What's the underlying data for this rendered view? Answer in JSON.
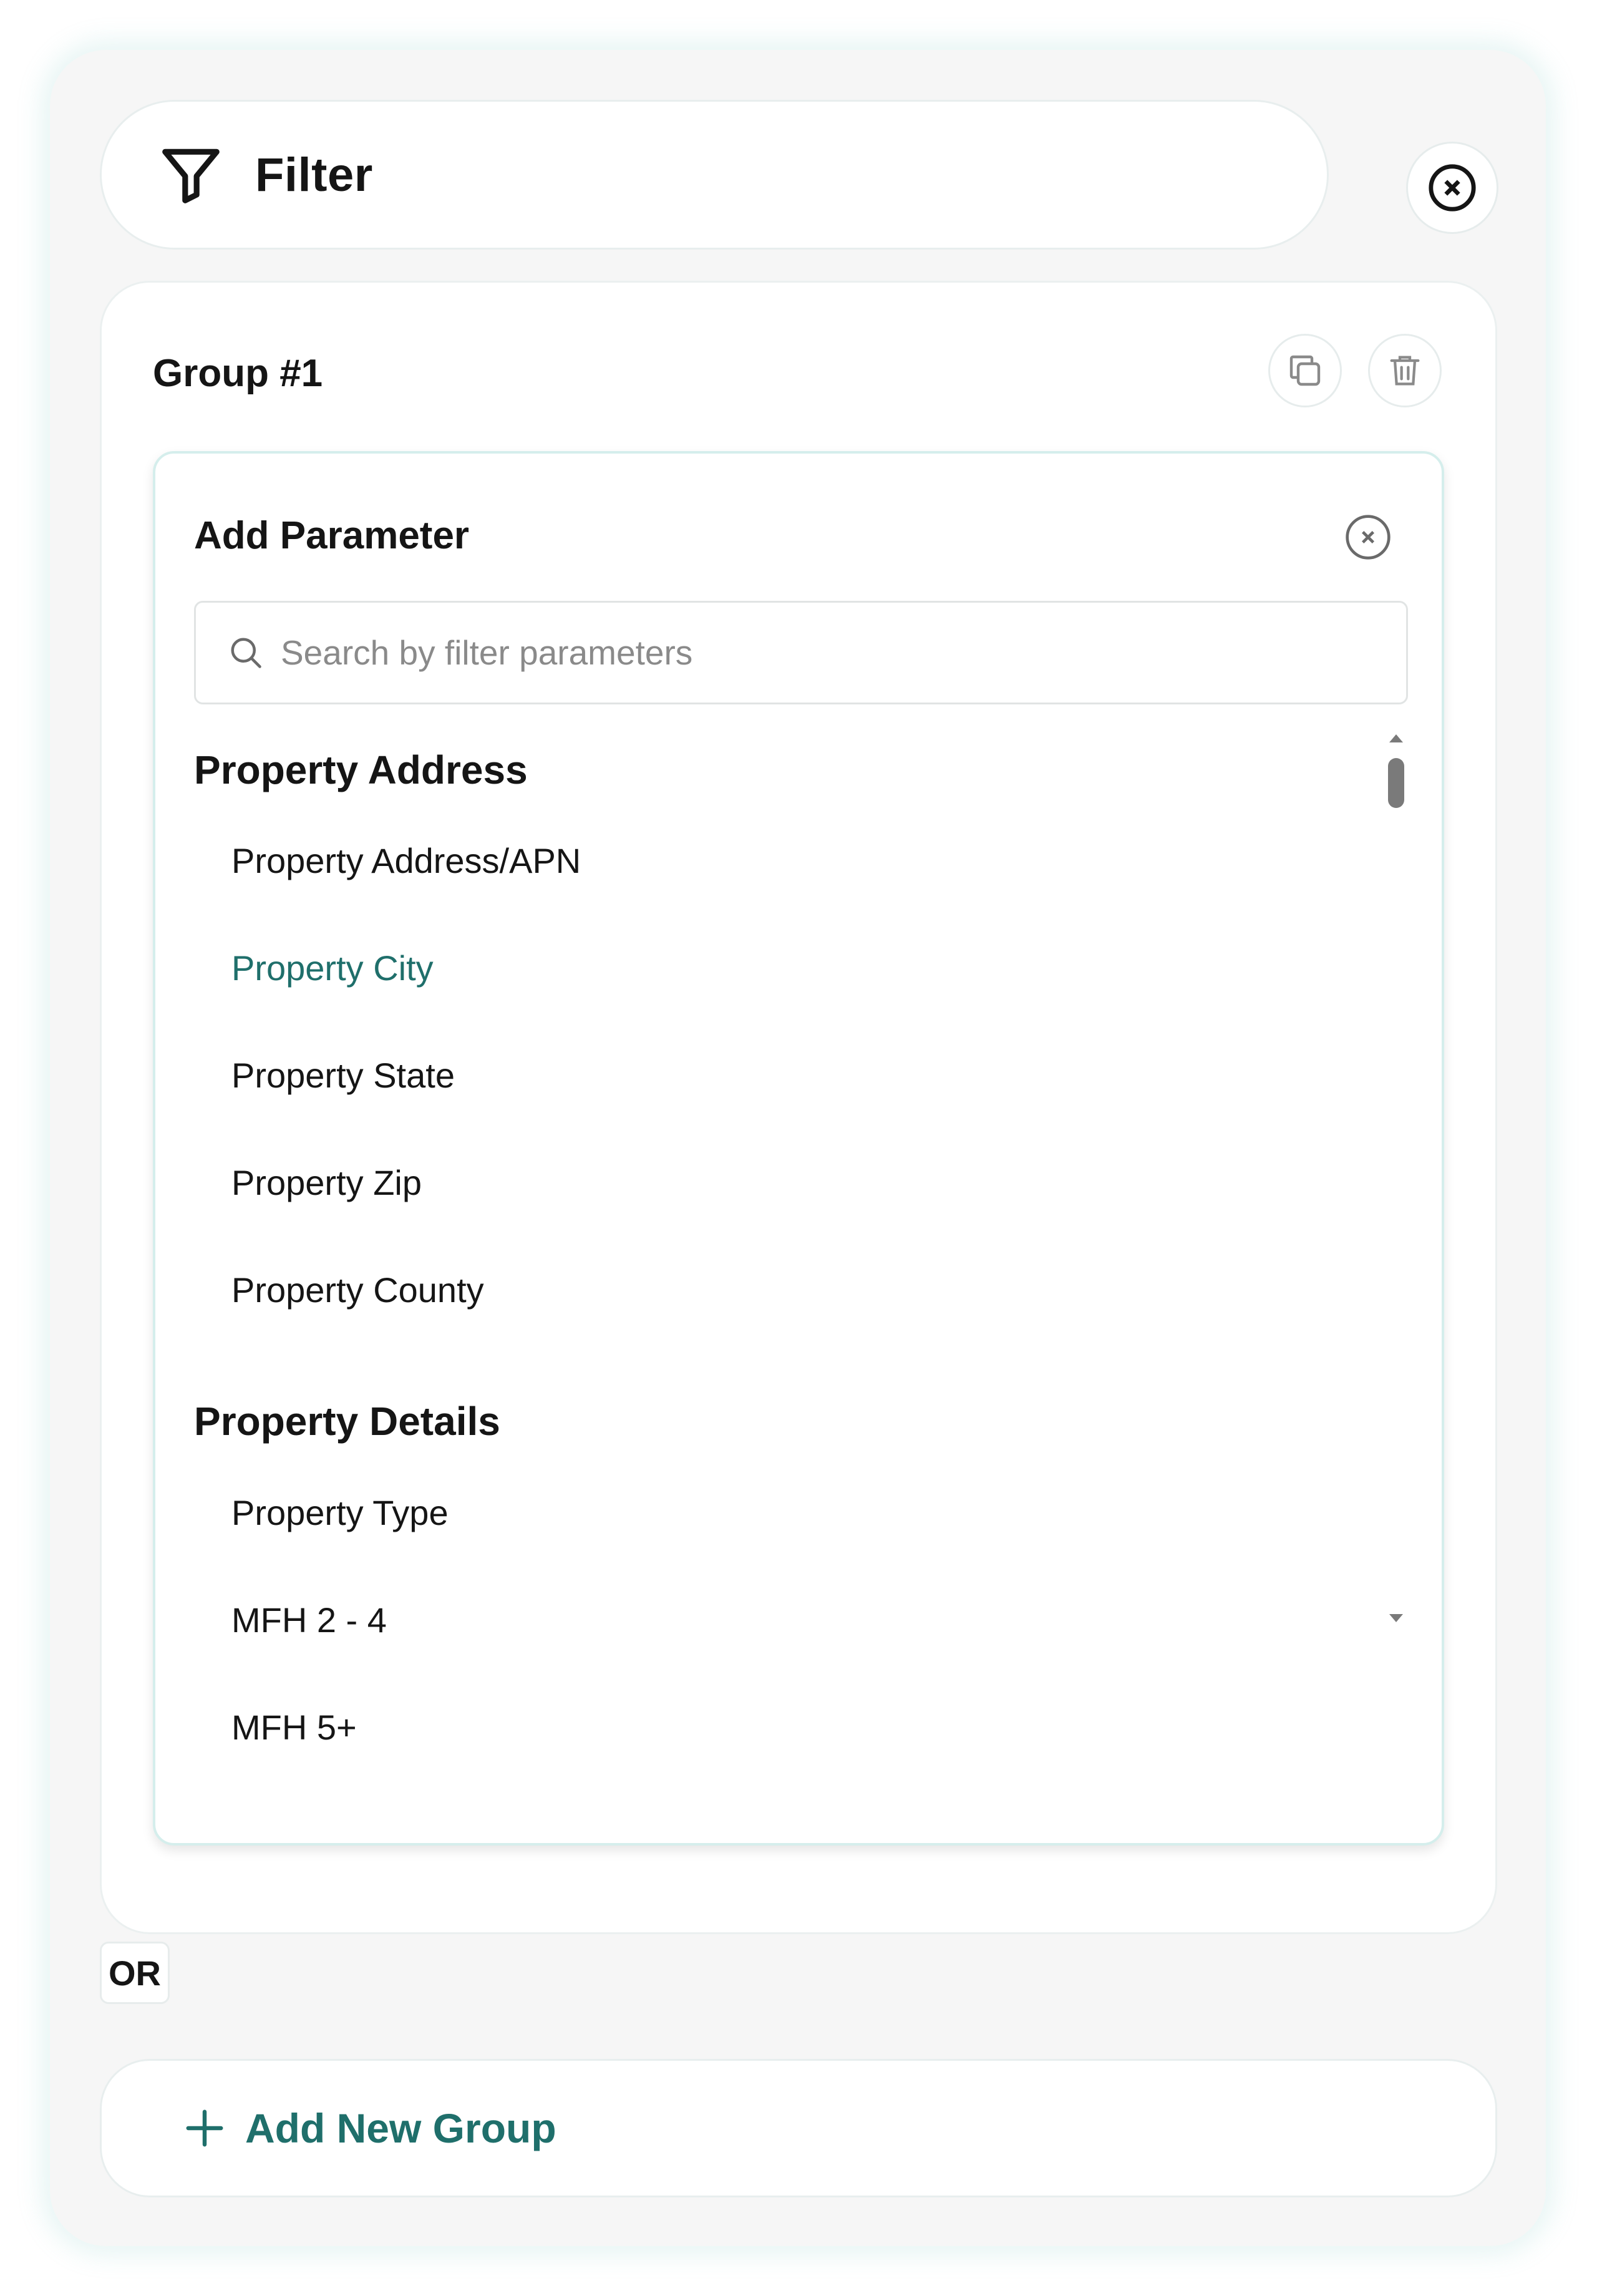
{
  "header": {
    "title": "Filter"
  },
  "group": {
    "title": "Group #1"
  },
  "add_parameter": {
    "title": "Add Parameter",
    "search_placeholder": "Search by filter parameters",
    "sections": [
      {
        "heading": "Property Address",
        "items": [
          "Property Address/APN",
          "Property City",
          "Property State",
          "Property Zip",
          "Property County"
        ]
      },
      {
        "heading": "Property Details",
        "items": [
          "Property Type",
          "MFH 2 - 4",
          "MFH 5+"
        ]
      }
    ],
    "highlighted_item": "Property City"
  },
  "or_label": "OR",
  "add_group_label": "Add New Group",
  "colors": {
    "accent": "#1f6f6b",
    "panel_bg": "#f6f6f6",
    "card_border": "#d5eeec"
  },
  "icons": {
    "filter": "filter-icon",
    "close": "close-icon",
    "copy": "copy-icon",
    "trash": "trash-icon",
    "search": "search-icon",
    "plus": "plus-icon"
  }
}
